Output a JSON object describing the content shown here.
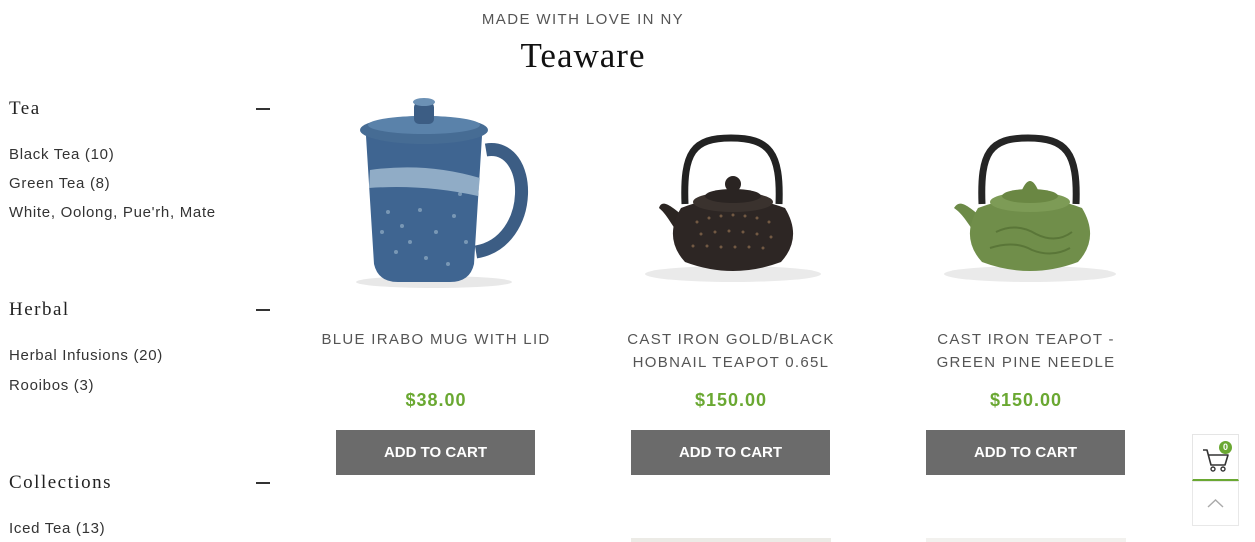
{
  "header": {
    "eyebrow": "MADE WITH LOVE IN NY",
    "title": "Teaware"
  },
  "sidebar": {
    "categories": [
      {
        "title": "Tea",
        "links": [
          "Black Tea (10)",
          "Green Tea (8)",
          "White, Oolong, Pue'rh, Mate"
        ]
      },
      {
        "title": "Herbal",
        "links": [
          "Herbal Infusions (20)",
          "Rooibos (3)"
        ]
      },
      {
        "title": "Collections",
        "links": [
          "Iced Tea (13)"
        ]
      }
    ]
  },
  "products": [
    {
      "name": "BLUE IRABO MUG WITH LID",
      "price": "$38.00",
      "button": "ADD TO CART"
    },
    {
      "name": "CAST IRON GOLD/BLACK HOBNAIL TEAPOT 0.65L",
      "price": "$150.00",
      "button": "ADD TO CART"
    },
    {
      "name": "CAST IRON TEAPOT - GREEN PINE NEEDLE",
      "price": "$150.00",
      "button": "ADD TO CART"
    }
  ],
  "cart": {
    "count": "0"
  },
  "colors": {
    "accent": "#6aa832",
    "button": "#6b6b6b"
  }
}
